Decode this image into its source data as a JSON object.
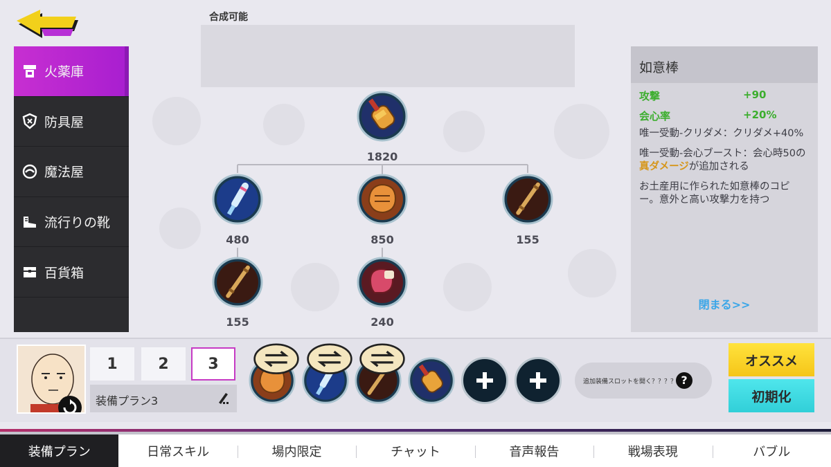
{
  "craftable": {
    "label": "合成可能"
  },
  "categories": [
    {
      "label": "火薬庫",
      "icon": "armory-icon",
      "active": true
    },
    {
      "label": "防具屋",
      "icon": "shield-icon",
      "active": false
    },
    {
      "label": "魔法屋",
      "icon": "magic-orb-icon",
      "active": false
    },
    {
      "label": "流行りの靴",
      "icon": "boot-icon",
      "active": false
    },
    {
      "label": "百貨箱",
      "icon": "box-icon",
      "active": false
    }
  ],
  "tree": {
    "root": {
      "item": "ruyi-staff-gauntlet-icon",
      "cost": "1820"
    },
    "children": [
      {
        "item": "baseball-bat-icon",
        "cost": "480"
      },
      {
        "item": "baseball-glove-icon",
        "cost": "850"
      },
      {
        "item": "wooden-staff-icon",
        "cost": "155"
      }
    ],
    "grandchildren": [
      {
        "item": "wooden-staff-icon",
        "cost": "155"
      },
      {
        "item": "boxing-glove-icon",
        "cost": "240"
      }
    ]
  },
  "detail": {
    "title": "如意棒",
    "stats": [
      {
        "label": "攻撃",
        "value": "+90"
      },
      {
        "label": "会心率",
        "value": "+20%"
      }
    ],
    "passive1": "唯一受動-クリダメ：クリダメ+40%",
    "passive2_pre": "唯一受動-会心ブースト：会心時50の",
    "passive2_hl": "真ダメージ",
    "passive2_post": "が追加される",
    "description": "お土産用に作られた如意棒のコピー。意外と高い攻撃力を持つ",
    "close_label": "閉まる>>",
    "colors": {
      "stat": "#3cae2e",
      "highlight": "#d6961a",
      "link": "#3aa6e8"
    }
  },
  "plan": {
    "buttons": [
      "1",
      "2",
      "3"
    ],
    "active_index": 2,
    "name": "装備プラン3",
    "slots": [
      "baseball-glove-icon",
      "baseball-bat-icon",
      "wooden-staff-icon",
      "ruyi-staff-gauntlet-icon"
    ],
    "extra_slot_text": "追加装備スロットを開く？？？？",
    "help": "?",
    "recommend_label": "オススメ",
    "reset_label": "初期化"
  },
  "tabs": [
    {
      "label": "装備プラン",
      "active": true
    },
    {
      "label": "日常スキル",
      "active": false
    },
    {
      "label": "場内限定",
      "active": false
    },
    {
      "label": "チャット",
      "active": false
    },
    {
      "label": "音声報告",
      "active": false
    },
    {
      "label": "戦場表現",
      "active": false
    },
    {
      "label": "バブル",
      "active": false
    }
  ]
}
